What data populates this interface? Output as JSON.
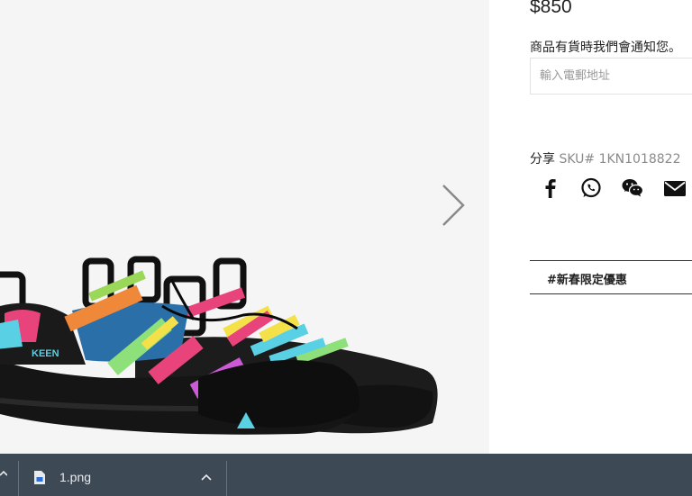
{
  "gallery": {
    "next_icon": "chevron-right-icon",
    "product_alt": "KEEN Newport H2 sandals in rainbow tie-dye straps with black soles",
    "logo_text": "KEEN"
  },
  "product": {
    "price": "$850",
    "notify_label": "商品有貨時我們會通知您。",
    "email_placeholder": "輸入電郵地址",
    "share_label": "分享",
    "sku": "SKU# 1KN1018822",
    "social_icons": [
      "facebook-icon",
      "whatsapp-icon",
      "wechat-icon",
      "email-icon"
    ],
    "promo": "#新春限定優惠"
  },
  "download_bar": {
    "file_name": "1.png",
    "file_icon": "file-icon",
    "chevron_icon": "chevron-up-icon",
    "background": "#3d4a55"
  }
}
